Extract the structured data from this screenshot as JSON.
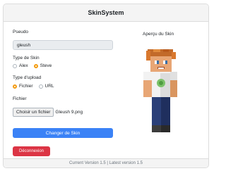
{
  "header": {
    "title": "SkinSystem"
  },
  "form": {
    "pseudo_label": "Pseudo",
    "pseudo_value": "gleush",
    "skin_type_label": "Type de Skin",
    "skin_type_options": [
      {
        "label": "Alex",
        "checked": false
      },
      {
        "label": "Steve",
        "checked": true
      }
    ],
    "upload_type_label": "Type d'upload",
    "upload_type_options": [
      {
        "label": "Fichier",
        "checked": true
      },
      {
        "label": "URL",
        "checked": false
      }
    ],
    "file_label": "Fichier",
    "file_button": "Choisir un fichier",
    "file_name": "Gleush 9.png",
    "submit_button": "Changer de Skin",
    "logout_button": "Déconnexion"
  },
  "preview": {
    "title": "Aperçu du Skin"
  },
  "footer": {
    "text": "Current Version 1.5 | Latest version 1.5"
  },
  "colors": {
    "accent": "#3b82f6",
    "danger": "#dc3545",
    "radio_checked": "#f39c12"
  }
}
